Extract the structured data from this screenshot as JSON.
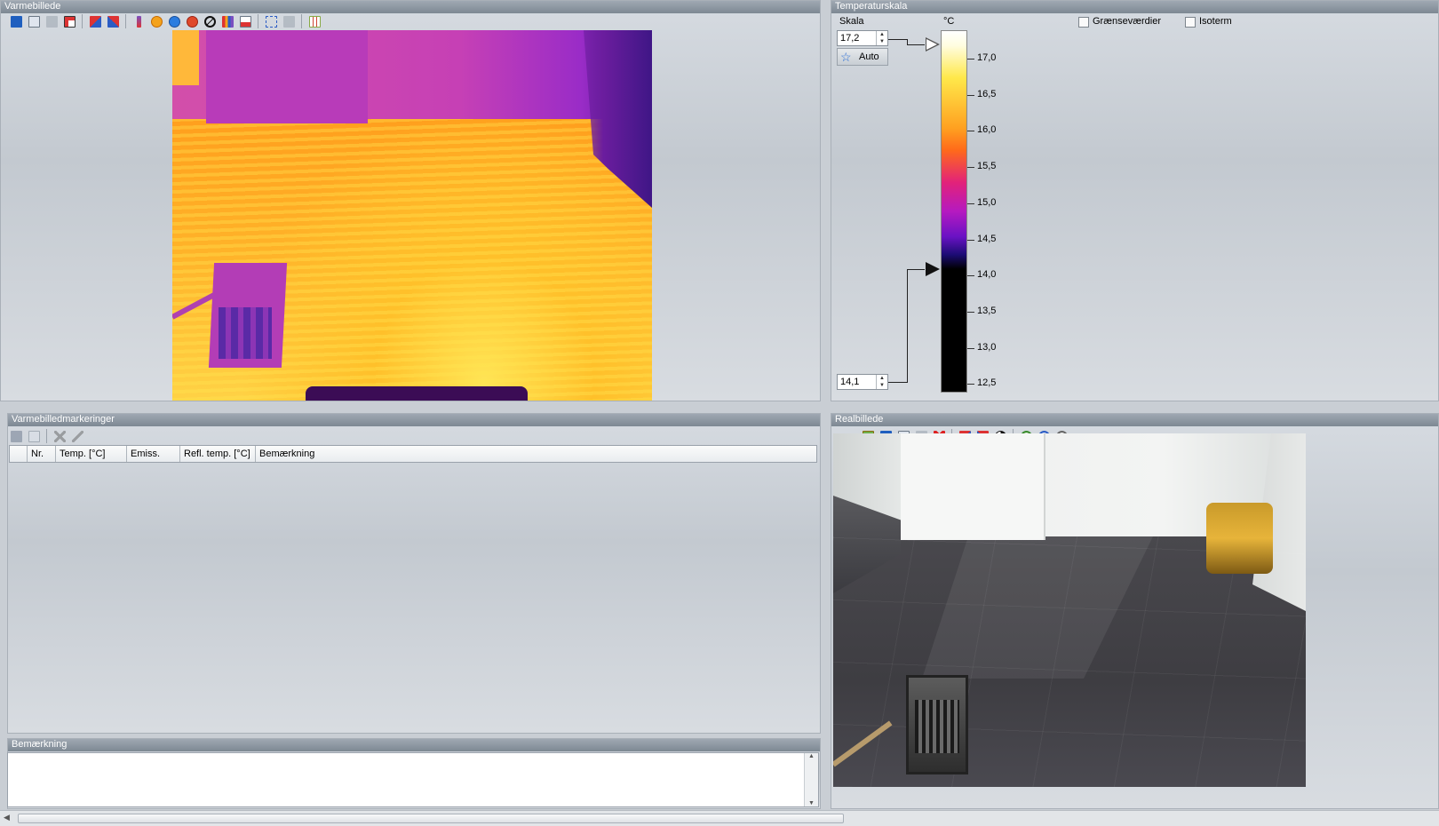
{
  "panels": {
    "thermal": "Varmebillede",
    "scale": "Temperaturskala",
    "markings": "Varmebilledmarkeringer",
    "real": "Realbillede",
    "note": "Bemærkning"
  },
  "scale": {
    "skala_label": "Skala",
    "unit": "°C",
    "max_value": "17,2",
    "min_value": "14,1",
    "auto_label": "Auto",
    "limit_values_label": "Grænseværdier",
    "isotherm_label": "Isoterm",
    "ticks": [
      "17,0",
      "16,5",
      "16,0",
      "15,5",
      "15,0",
      "14,5",
      "14,0",
      "13,5",
      "13,0",
      "12,5"
    ]
  },
  "table": {
    "columns": [
      "",
      "Nr.",
      "Temp. [°C]",
      "Emiss.",
      "Refl. temp. [°C]",
      "Bemærkning"
    ],
    "rows": []
  },
  "colors": {
    "panel_title_bg": "#8a949e",
    "accent_blue": "#1f5fbf"
  },
  "icons": {
    "thermal_toolbar": [
      "save-icon",
      "copy-icon",
      "print-icon",
      "export-icon",
      "rotate-icon",
      "flip-icon",
      "thermometer-icon",
      "hot-spot-icon",
      "cold-spot-icon",
      "marker-icon",
      "clear-icon",
      "histogram-icon",
      "profile-icon",
      "select-area-icon",
      "delete-area-icon",
      "grid-icon"
    ],
    "real_toolbar": [
      "open-icon",
      "save-icon",
      "copy-icon",
      "delete-icon",
      "close-icon",
      "rotate-icon",
      "flip-icon",
      "contrast-icon",
      "zoom-in-icon",
      "zoom-out-icon",
      "zoom-fit-icon"
    ]
  }
}
